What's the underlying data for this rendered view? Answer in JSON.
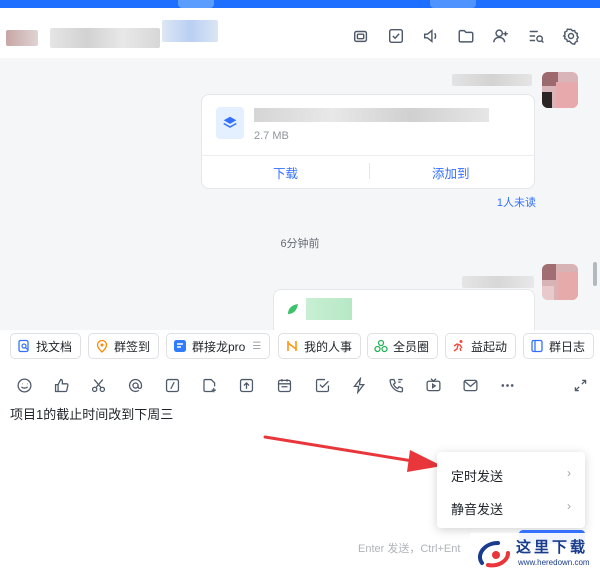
{
  "file_message": {
    "size": "2.7 MB",
    "download_label": "下载",
    "add_to_label": "添加到",
    "read_status": "1人未读"
  },
  "timestamp": "6分钟前",
  "quick_apps": [
    {
      "label": "找文档",
      "icon": "doc-search-icon"
    },
    {
      "label": "群签到",
      "icon": "location-pin-icon"
    },
    {
      "label": "群接龙pro",
      "icon": "relay-icon"
    },
    {
      "label": "我的人事",
      "icon": "hr-icon"
    },
    {
      "label": "全员圈",
      "icon": "circle-icon"
    },
    {
      "label": "益起动",
      "icon": "runner-icon"
    },
    {
      "label": "群日志",
      "icon": "log-icon"
    }
  ],
  "editor": {
    "text": "项目1的截止时间改到下周三"
  },
  "send_menu": {
    "scheduled_send": "定时发送",
    "silent_send": "静音发送"
  },
  "input_hint": "Enter 发送，Ctrl+Ent",
  "watermark": {
    "text": "这里下载",
    "url": "www.heredown.com"
  },
  "colors": {
    "accent": "#3370ff",
    "top_bar": "#1e6fff",
    "arrow": "#e8363a"
  }
}
